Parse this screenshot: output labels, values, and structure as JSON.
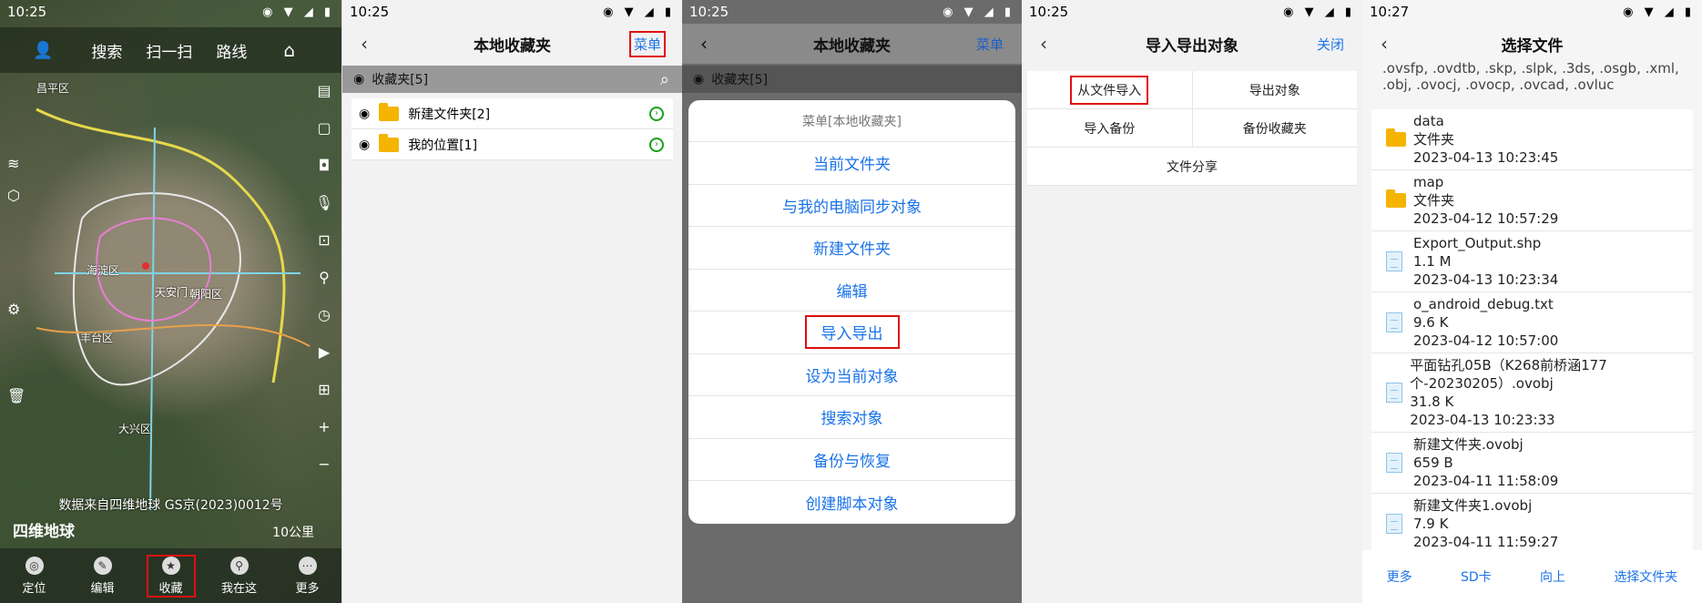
{
  "panel1": {
    "time": "10:25",
    "status_icons": "◉ ▼ ◢ ▮",
    "topbar": {
      "search": "搜索",
      "scan": "扫一扫",
      "route": "路线"
    },
    "map_labels": [
      "昌平区",
      "海淀区",
      "天安门",
      "朝阳区",
      "丰台区",
      "大兴区"
    ],
    "data_source": "数据来自四维地球 GS京(2023)0012号",
    "brand": "四维地球",
    "scale": "10公里",
    "tabs": [
      "定位",
      "编辑",
      "收藏",
      "我在这",
      "更多"
    ]
  },
  "panel2": {
    "time": "10:25",
    "status_icons": "◉ ▼ ◢ ▮",
    "title": "本地收藏夹",
    "menu": "菜单",
    "folder_bar": "收藏夹[5]",
    "rows": [
      "新建文件夹[2]",
      "我的位置[1]"
    ]
  },
  "panel3": {
    "time": "10:25",
    "status_icons": "◉ ▼ ◢ ▮",
    "title": "本地收藏夹",
    "menu": "菜单",
    "folder_bar": "收藏夹[5]",
    "menu_title": "菜单[本地收藏夹]",
    "items": [
      "当前文件夹",
      "与我的电脑同步对象",
      "新建文件夹",
      "编辑",
      "导入导出",
      "设为当前对象",
      "搜索对象",
      "备份与恢复",
      "创建脚本对象"
    ]
  },
  "panel4": {
    "time": "10:25",
    "status_icons": "◉ ▼ ◢ ▮",
    "title": "导入导出对象",
    "close": "关闭",
    "cells": [
      "从文件导入",
      "导出对象",
      "导入备份",
      "备份收藏夹",
      "文件分享"
    ]
  },
  "panel5": {
    "time": "10:27",
    "status_icons": "◉ ▼ ◢ ▮",
    "title": "选择文件",
    "ext_text": ".ovsfp, .ovdtb, .skp, .slpk, .3ds, .osgb, .xml, .obj, .ovocj, .ovocp, .ovcad, .ovluc",
    "files": [
      {
        "type": "folder",
        "lines": [
          "data",
          "文件夹",
          "2023-04-13 10:23:45"
        ]
      },
      {
        "type": "folder",
        "lines": [
          "map",
          "文件夹",
          "2023-04-12 10:57:29"
        ]
      },
      {
        "type": "file",
        "lines": [
          "Export_Output.shp",
          "1.1 M",
          "2023-04-13 10:23:34"
        ]
      },
      {
        "type": "file",
        "lines": [
          "o_android_debug.txt",
          "9.6 K",
          "2023-04-12 10:57:00"
        ]
      },
      {
        "type": "file",
        "lines": [
          "平面钻孔05B（K268前桥涵177个-20230205）.ovobj",
          "31.8 K",
          "2023-04-13 10:23:33"
        ]
      },
      {
        "type": "file",
        "lines": [
          "新建文件夹.ovobj",
          "659 B",
          "2023-04-11 11:58:09"
        ]
      },
      {
        "type": "file",
        "lines": [
          "新建文件夹1.ovobj",
          "7.9 K",
          "2023-04-11 11:59:27"
        ]
      }
    ],
    "bottom": [
      "更多",
      "SD卡",
      "向上",
      "选择文件夹"
    ]
  }
}
